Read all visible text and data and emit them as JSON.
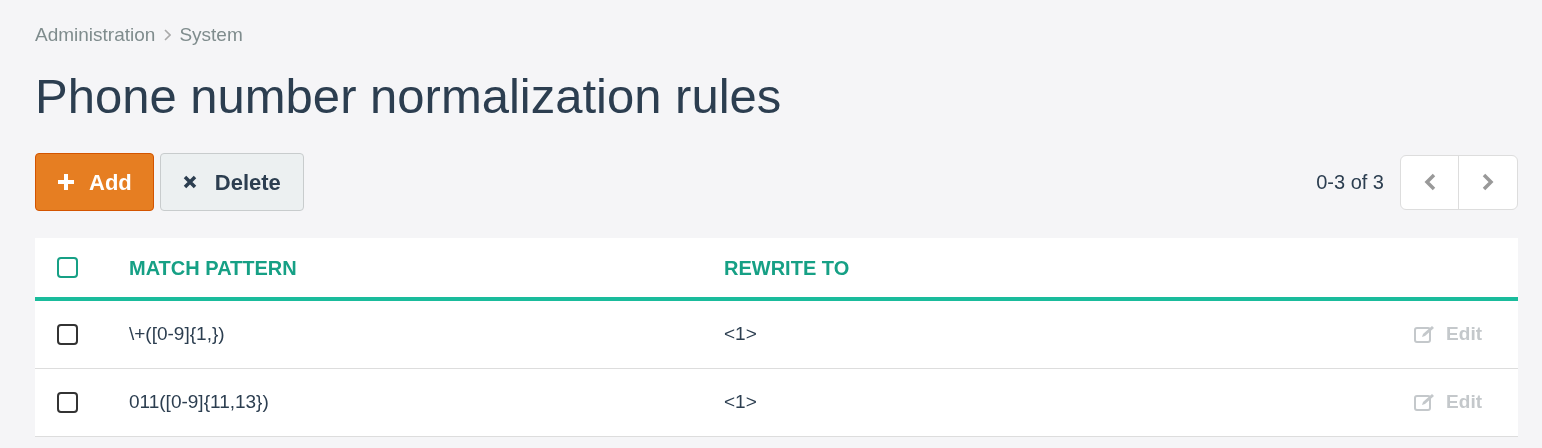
{
  "breadcrumb": [
    {
      "label": "Administration"
    },
    {
      "label": "System"
    }
  ],
  "title": "Phone number normalization rules",
  "toolbar": {
    "add_label": "Add",
    "delete_label": "Delete",
    "pagination": "0-3 of 3"
  },
  "table": {
    "select_all": {
      "checked": false
    },
    "columns": [
      "MATCH PATTERN",
      "REWRITE TO"
    ],
    "rows": [
      {
        "checked": false,
        "match_pattern": "\\+([0-9]{1,})",
        "rewrite_to": "<1>",
        "action": "Edit"
      },
      {
        "checked": false,
        "match_pattern": "011([0-9]{11,13})",
        "rewrite_to": "<1>",
        "action": "Edit"
      }
    ]
  }
}
